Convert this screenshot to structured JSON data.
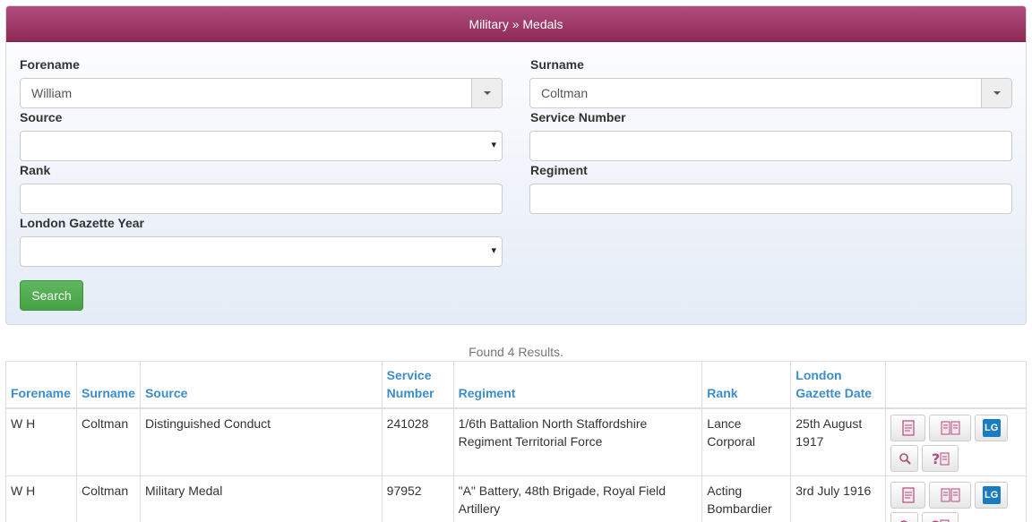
{
  "panel": {
    "title": "Military » Medals"
  },
  "form": {
    "forename_label": "Forename",
    "forename_value": "William",
    "surname_label": "Surname",
    "surname_value": "Coltman",
    "source_label": "Source",
    "service_number_label": "Service Number",
    "rank_label": "Rank",
    "regiment_label": "Regiment",
    "gazette_year_label": "London Gazette Year",
    "search_button": "Search",
    "select_arrow": "▾"
  },
  "results": {
    "count_text": "Found 4 Results.",
    "headers": {
      "forename": "Forename",
      "surname": "Surname",
      "source": "Source",
      "service_number_line1": "Service",
      "service_number_line2": "Number",
      "regiment": "Regiment",
      "rank": "Rank",
      "gazette_line1": "London",
      "gazette_line2": "Gazette Date"
    },
    "rows": [
      {
        "forename": "W H",
        "surname": "Coltman",
        "source": "Distinguished Conduct",
        "service_number": "241028",
        "regiment_line1": "1/6th Battalion North Staffordshire",
        "regiment_line2": "Regiment Territorial Force",
        "rank_line1": "Lance",
        "rank_line2": "Corporal",
        "date_line1": "25th August",
        "date_line2": "1917"
      },
      {
        "forename": "W H",
        "surname": "Coltman",
        "source": "Military Medal",
        "service_number": "97952",
        "regiment_line1": "\"A\" Battery, 48th Brigade, Royal Field",
        "regiment_line2": "Artillery",
        "rank_line1": "Acting",
        "rank_line2": "Bombardier",
        "date_line1": "3rd July 1916",
        "date_line2": ""
      }
    ],
    "action_badge": "LG"
  },
  "colors": {
    "heading": "#9c3566",
    "link_header": "#3c8dc9",
    "search_button": "#4cae4c",
    "lg_badge": "#1a7cc0"
  }
}
